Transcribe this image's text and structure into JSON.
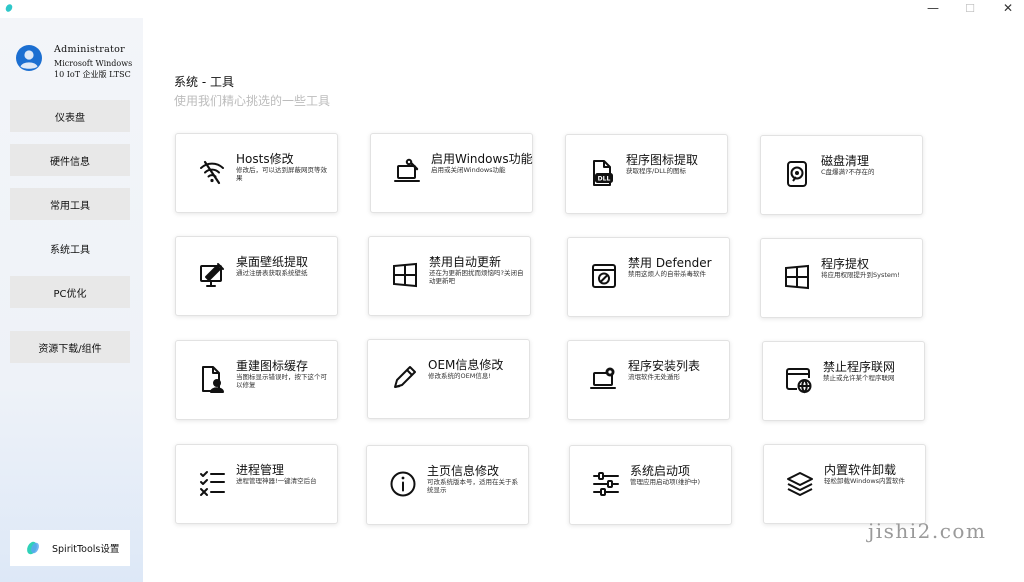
{
  "window": {
    "minimize_glyph": "—",
    "maximize_glyph": "☐",
    "close_glyph": "✕"
  },
  "user": {
    "name": "Administrator",
    "os_line1": "Microsoft Windows",
    "os_line2": "10 IoT 企业版 LTSC"
  },
  "nav": [
    {
      "label": "仪表盘",
      "active": false
    },
    {
      "label": "硬件信息",
      "active": false
    },
    {
      "label": "常用工具",
      "active": false
    },
    {
      "label": "系统工具",
      "active": true
    },
    {
      "label": "PC优化",
      "active": false
    },
    {
      "label": "资源下载/组件",
      "active": false
    }
  ],
  "settings_label": "SpiritTools设置",
  "header": {
    "title": "系统 - 工具",
    "subtitle": "使用我们精心挑选的一些工具"
  },
  "cards": [
    {
      "title": "Hosts修改",
      "desc": "修改后，可以达到屏蔽网页等效果",
      "icon": "wifi-icon"
    },
    {
      "title": "启用Windows功能",
      "desc": "启用或关闭Windows功能",
      "icon": "laptop-tools-icon"
    },
    {
      "title": "程序图标提取",
      "desc": "获取程序/DLL的图标",
      "icon": "dll-file-icon"
    },
    {
      "title": "磁盘清理",
      "desc": "C盘爆满?不存在的",
      "icon": "disk-icon"
    },
    {
      "title": "桌面壁纸提取",
      "desc": "通过注册表获取系统壁纸",
      "icon": "monitor-brush-icon"
    },
    {
      "title": "禁用自动更新",
      "desc": "还在为更新困扰而烦恼吗?关闭自动更新吧",
      "icon": "windows-logo-icon"
    },
    {
      "title": "禁用 Defender",
      "desc": "禁用这烦人的自带杀毒软件",
      "icon": "blocked-window-icon"
    },
    {
      "title": "程序提权",
      "desc": "将应用权限提升到System!",
      "icon": "windows-logo-icon"
    },
    {
      "title": "重建图标缓存",
      "desc": "当图标显示错误时，按下这个可以修复",
      "icon": "file-user-icon"
    },
    {
      "title": "OEM信息修改",
      "desc": "修改系统的OEM信息!",
      "icon": "pencil-icon"
    },
    {
      "title": "程序安装列表",
      "desc": "流氓软件无处遁形",
      "icon": "laptop-gear-icon"
    },
    {
      "title": "禁止程序联网",
      "desc": "禁止或允许某个程序联网",
      "icon": "globe-window-icon"
    },
    {
      "title": "进程管理",
      "desc": "进程管理神器!一键清空后台",
      "icon": "checklist-icon"
    },
    {
      "title": "主页信息修改",
      "desc": "可改系统版本号，适用在关于系统显示",
      "icon": "info-circle-icon"
    },
    {
      "title": "系统启动项",
      "desc": "管理应用启动项(维护中)",
      "icon": "sliders-icon"
    },
    {
      "title": "内置软件卸载",
      "desc": "轻松卸载Windows内置软件",
      "icon": "layers-icon"
    }
  ],
  "watermark": "jishi2.com",
  "colors": {
    "accent": "#1c6fd1",
    "sidebar": "#f3f5f9",
    "nav_item": "#e8e8e8"
  }
}
